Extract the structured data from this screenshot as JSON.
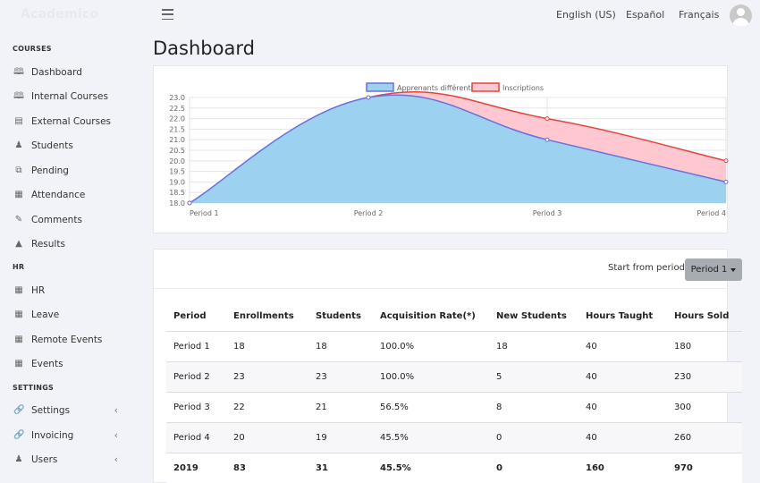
{
  "app": {
    "brand": "Academico"
  },
  "header": {
    "languages": [
      "English (US)",
      "Español",
      "Français"
    ]
  },
  "sidebar": {
    "sections": [
      {
        "title": "COURSES"
      },
      {
        "title": "HR"
      },
      {
        "title": "SETTINGS"
      }
    ],
    "items": [
      {
        "label": "Dashboard",
        "icon": "book-open-icon"
      },
      {
        "label": "Internal Courses",
        "icon": "book-open-icon"
      },
      {
        "label": "External Courses",
        "icon": "building-icon"
      },
      {
        "label": "Students",
        "icon": "user-icon"
      },
      {
        "label": "Pending",
        "icon": "copy-icon"
      },
      {
        "label": "Attendance",
        "icon": "calendar-icon"
      },
      {
        "label": "Comments",
        "icon": "pencil-icon"
      },
      {
        "label": "Results",
        "icon": "graduation-cap-icon"
      },
      {
        "label": "HR",
        "icon": "calendar-icon"
      },
      {
        "label": "Leave",
        "icon": "calendar-icon"
      },
      {
        "label": "Remote Events",
        "icon": "calendar-icon"
      },
      {
        "label": "Events",
        "icon": "calendar-icon"
      },
      {
        "label": "Settings",
        "icon": "link-icon"
      },
      {
        "label": "Invoicing",
        "icon": "link-icon"
      },
      {
        "label": "Users",
        "icon": "users-icon"
      }
    ]
  },
  "main": {
    "title": "Dashboard",
    "filter": {
      "label": "Start from period:",
      "selected": "Period 1"
    }
  },
  "chart_data": {
    "type": "area",
    "categories": [
      "Period 1",
      "Period 2",
      "Period 3",
      "Period 4"
    ],
    "series": [
      {
        "name": "Apprenants différents",
        "values": [
          18,
          23,
          21,
          19
        ],
        "color": "#6b6fdb",
        "fill": "#9dd1f0"
      },
      {
        "name": "Inscriptions",
        "values": [
          18,
          23,
          22,
          20
        ],
        "color": "#e0463f",
        "fill": "#ffc7cf"
      }
    ],
    "ylim": [
      18,
      23
    ],
    "yticks": [
      "23.0",
      "22.5",
      "22.0",
      "21.5",
      "21.0",
      "20.5",
      "20.0",
      "19.5",
      "19.0",
      "18.5",
      "18.0"
    ],
    "legend": "top",
    "grid": true
  },
  "table": {
    "headers": [
      "Period",
      "Enrollments",
      "Students",
      "Acquisition Rate(*)",
      "New Students",
      "Hours Taught",
      "Hours Sold"
    ],
    "rows": [
      [
        "Period 1",
        "18",
        "18",
        "100.0%",
        "18",
        "40",
        "180"
      ],
      [
        "Period 2",
        "23",
        "23",
        "100.0%",
        "5",
        "40",
        "230"
      ],
      [
        "Period 3",
        "22",
        "21",
        "56.5%",
        "8",
        "40",
        "300"
      ],
      [
        "Period 4",
        "20",
        "19",
        "45.5%",
        "0",
        "40",
        "260"
      ]
    ],
    "total": [
      "2019",
      "83",
      "31",
      "45.5%",
      "0",
      "160",
      "970"
    ]
  }
}
